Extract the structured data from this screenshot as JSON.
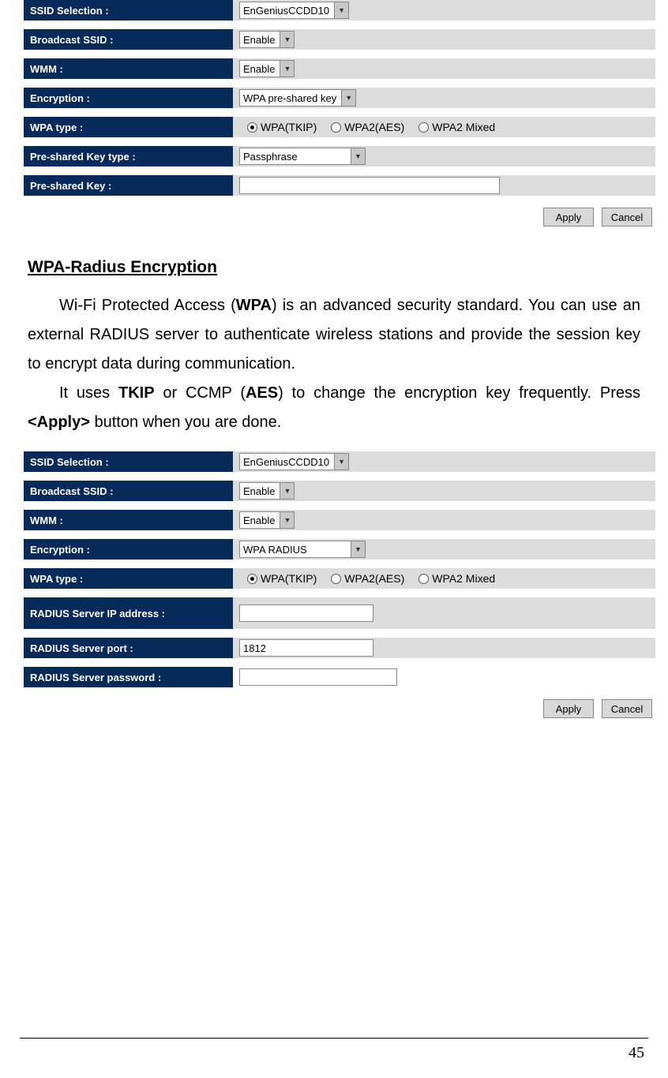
{
  "panel1": {
    "ssid_label": "SSID Selection :",
    "ssid_value": "EnGeniusCCDD10",
    "broadcast_label": "Broadcast SSID :",
    "broadcast_value": "Enable",
    "wmm_label": "WMM :",
    "wmm_value": "Enable",
    "enc_label": "Encryption :",
    "enc_value": "WPA pre-shared key",
    "wpa_type_label": "WPA type :",
    "wpa_opts": {
      "o1": "WPA(TKIP)",
      "o2": "WPA2(AES)",
      "o3": "WPA2 Mixed"
    },
    "psk_type_label": "Pre-shared Key type :",
    "psk_type_value": "Passphrase",
    "psk_label": "Pre-shared Key :",
    "apply": "Apply",
    "cancel": "Cancel"
  },
  "heading": "WPA-Radius Encryption",
  "para1_a": "Wi-Fi Protected Access (",
  "para1_b": "WPA",
  "para1_c": ") is an advanced security standard. You can use an external RADIUS server to authenticate wireless stations and provide the session key to encrypt data during communication.",
  "para2_a": "It uses ",
  "para2_b": "TKIP",
  "para2_c": " or CCMP (",
  "para2_d": "AES",
  "para2_e": ") to change the encryption key frequently. Press ",
  "para2_f": "<Apply>",
  "para2_g": " button when you are done.",
  "panel2": {
    "ssid_label": "SSID Selection :",
    "ssid_value": "EnGeniusCCDD10",
    "broadcast_label": "Broadcast SSID :",
    "broadcast_value": "Enable",
    "wmm_label": "WMM :",
    "wmm_value": "Enable",
    "enc_label": "Encryption :",
    "enc_value": "WPA RADIUS",
    "wpa_type_label": "WPA type :",
    "wpa_opts": {
      "o1": "WPA(TKIP)",
      "o2": "WPA2(AES)",
      "o3": "WPA2 Mixed"
    },
    "radius_ip_label": "RADIUS Server IP address :",
    "radius_port_label": "RADIUS Server port :",
    "radius_port_value": "1812",
    "radius_pw_label": "RADIUS Server password :",
    "apply": "Apply",
    "cancel": "Cancel"
  },
  "page_number": "45"
}
